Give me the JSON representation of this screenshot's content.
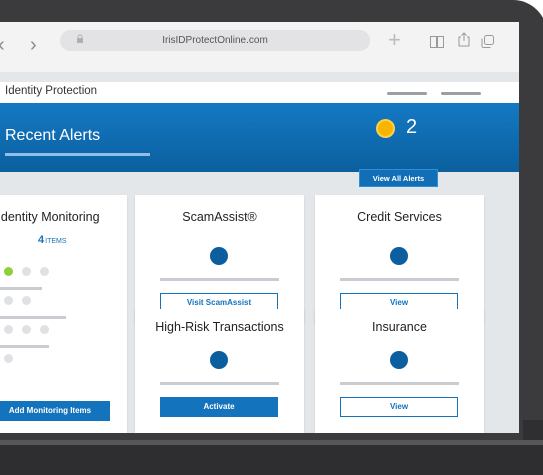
{
  "browser": {
    "back_glyph": "‹",
    "forward_glyph": "›",
    "url": "IrisIDProtectOnline.com",
    "new_tab_glyph": "+",
    "icons": [
      "lock-icon",
      "book-icon",
      "share-icon",
      "tabs-icon"
    ]
  },
  "app": {
    "title": "Identity Protection"
  },
  "banner": {
    "title": "Recent Alerts",
    "alert_count": "2",
    "view_all_label": "View All Alerts",
    "alert_color": "#f7b500"
  },
  "cards": {
    "monitoring": {
      "title": "Identity Monitoring",
      "count": "4",
      "count_unit": "ITEMS",
      "button_label": "Add Monitoring Items"
    },
    "scamassist": {
      "title": "ScamAssist®",
      "button_label": "Visit ScamAssist"
    },
    "credit": {
      "title": "Credit Services",
      "button_label": "View"
    },
    "high_risk": {
      "title": "High-Risk Transactions",
      "button_label": "Activate"
    },
    "insurance": {
      "title": "Insurance",
      "button_label": "View"
    }
  },
  "colors": {
    "brand_blue": "#1473bd",
    "banner_blue": "#0b5f9e",
    "status_green": "#8fcf3a",
    "device_frame": "#3b3b3d"
  }
}
